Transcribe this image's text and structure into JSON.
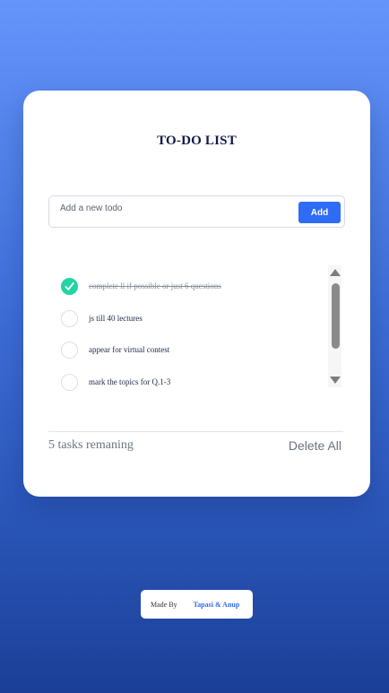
{
  "header": {
    "title": "TO-DO LIST"
  },
  "input": {
    "placeholder": "Add a new todo",
    "value": ""
  },
  "add_button": {
    "label": "Add"
  },
  "todos": [
    {
      "text": "complete ll if possible or just 6 questions",
      "completed": true
    },
    {
      "text": "js till 40 lectures",
      "completed": false
    },
    {
      "text": "appear for virtual contest",
      "completed": false
    },
    {
      "text": "mark the topics for Q.1-3",
      "completed": false
    }
  ],
  "footer": {
    "remaining_label": "5 tasks remaning",
    "delete_all_label": "Delete All"
  },
  "credit": {
    "made_by": "Made By",
    "authors": "Tapasi & Anup"
  },
  "colors": {
    "accent": "#2f6cf5",
    "check": "#22d3a6",
    "title": "#0f1b4a"
  },
  "icons": {
    "checked": "check-icon"
  }
}
